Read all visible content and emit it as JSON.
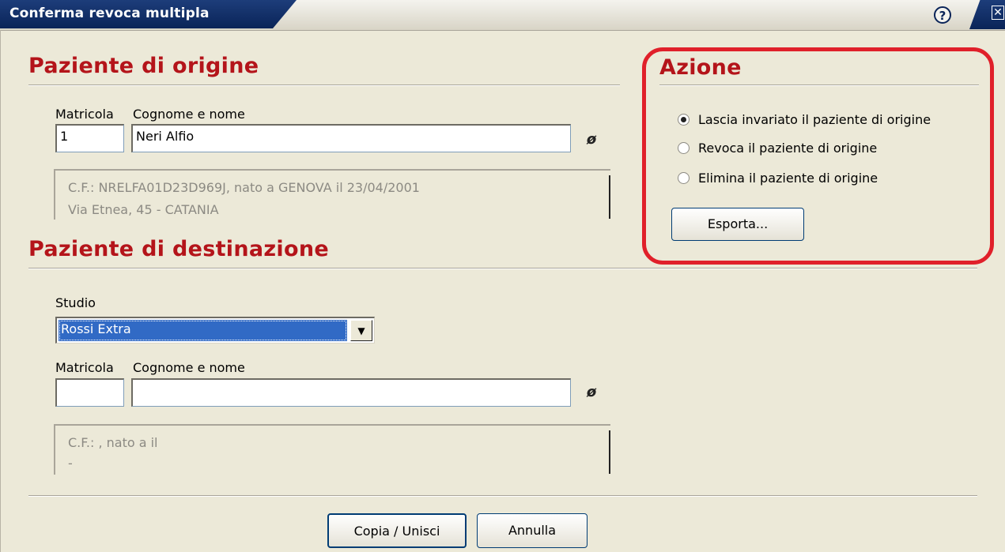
{
  "window": {
    "title": "Conferma revoca multipla",
    "help_icon": "help-icon",
    "help_glyph": "?",
    "close_icon": "close-icon",
    "close_glyph": "✕"
  },
  "origin": {
    "section_title": "Paziente di origine",
    "matricola_label": "Matricola",
    "name_label": "Cognome e nome",
    "matricola_value": "1",
    "name_value": "Neri Alfio",
    "lookup_icon": "pin-icon",
    "lookup_glyph": "ø",
    "info_line1": "C.F.: NRELFA01D23D969J, nato a GENOVA il 23/04/2001",
    "info_line2": "Via Etnea, 45 - CATANIA"
  },
  "destination": {
    "section_title": "Paziente di destinazione",
    "studio_label": "Studio",
    "studio_selected": "Rossi Extra",
    "dropdown_glyph": "▼",
    "matricola_label": "Matricola",
    "name_label": "Cognome e nome",
    "matricola_value": "",
    "name_value": "",
    "lookup_icon": "pin-icon",
    "lookup_glyph": "ø",
    "info_line1": "C.F.: , nato a  il",
    "info_line2": " -"
  },
  "action": {
    "section_title": "Azione",
    "options": [
      {
        "label": "Lascia invariato il paziente di origine",
        "checked": true
      },
      {
        "label": "Revoca il paziente di origine",
        "checked": false
      },
      {
        "label": "Elimina il paziente di origine",
        "checked": false
      }
    ],
    "export_button": "Esporta...",
    "highlight_color": "#e0202a"
  },
  "footer": {
    "copy_button": "Copia / Unisci",
    "cancel_button": "Annulla"
  },
  "colors": {
    "section_title": "#b4141a",
    "titlebar": "#0a2458",
    "selection": "#316ac5"
  }
}
